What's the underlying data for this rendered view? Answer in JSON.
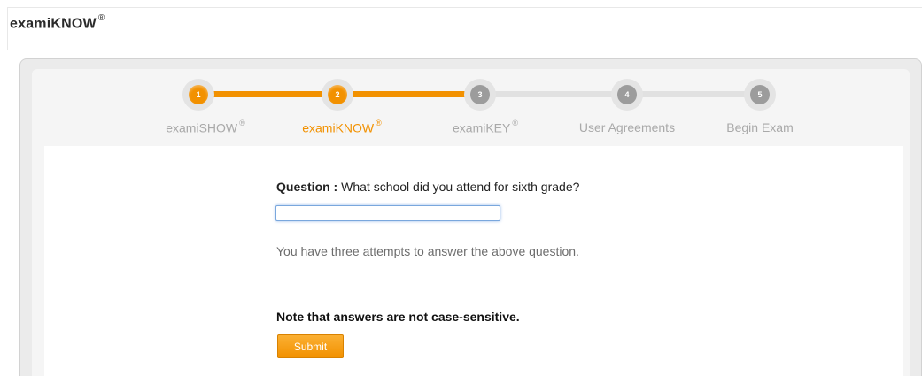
{
  "header": {
    "app_title": "examiKNOW",
    "registered_mark": "®"
  },
  "stepper": {
    "steps": [
      {
        "number": "1",
        "label": "examiSHOW",
        "mark": "®",
        "state": "completed"
      },
      {
        "number": "2",
        "label": "examiKNOW",
        "mark": "®",
        "state": "current"
      },
      {
        "number": "3",
        "label": "examiKEY",
        "mark": "®",
        "state": "upcoming"
      },
      {
        "number": "4",
        "label": "User Agreements",
        "mark": "",
        "state": "upcoming"
      },
      {
        "number": "5",
        "label": "Begin Exam",
        "mark": "",
        "state": "upcoming"
      }
    ]
  },
  "form": {
    "question_label": "Question :",
    "question_text": "What school did you attend for sixth grade?",
    "answer_value": "",
    "attempts_text": "You have three attempts to answer the above question.",
    "note_text": "Note that answers are not case-sensitive.",
    "submit_label": "Submit"
  },
  "colors": {
    "accent": "#f29100",
    "inactive_step": "#9c9c9c",
    "input_focus": "#7aa7dd"
  }
}
